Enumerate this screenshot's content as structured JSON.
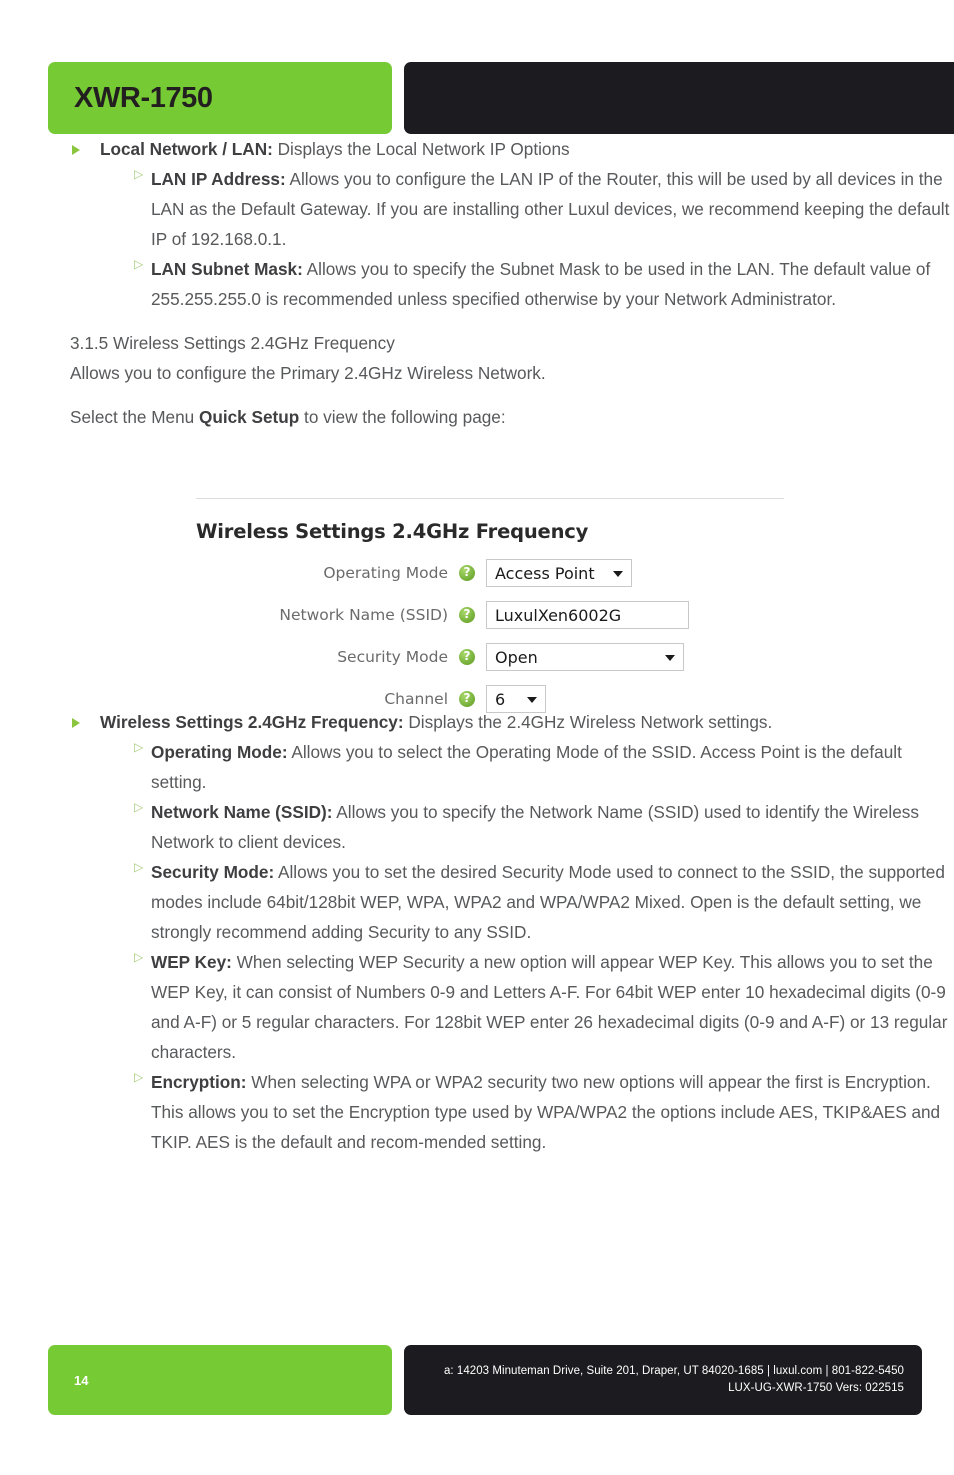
{
  "header": {
    "title": "XWR-1750"
  },
  "content": {
    "bullets_top": [
      {
        "label": "Local Network / LAN:",
        "text": " Displays the Local Network IP Options",
        "children": [
          {
            "label": "LAN IP Address:",
            "text": " Allows you to configure the LAN IP of the Router, this will be used by all devices in the LAN as the Default Gateway. If you are installing other Luxul devices, we recommend keeping the default IP of 192.168.0.1."
          },
          {
            "label": "LAN Subnet Mask:",
            "text": " Allows you to specify the Subnet Mask to be used in the LAN. The default value of 255.255.255.0 is recommended unless specified otherwise by your Network Administrator."
          }
        ]
      }
    ],
    "section_number_title": "3.1.5 Wireless Settings 2.4GHz Frequency",
    "section_intro": "Allows you to configure the Primary 2.4GHz Wireless Network.",
    "select_menu_pre": "Select the Menu ",
    "select_menu_bold": "Quick Setup",
    "select_menu_post": " to view the following page:",
    "bullets_bottom": [
      {
        "label": "Wireless Settings 2.4GHz Frequency:",
        "text": " Displays the 2.4GHz Wireless Network settings.",
        "children": [
          {
            "label": "Operating Mode:",
            "text": " Allows you to select the Operating Mode of the SSID. Access Point is the default setting."
          },
          {
            "label": "Network Name (SSID):",
            "text": " Allows you to specify the Network Name (SSID) used to identify the Wireless Network to client devices."
          },
          {
            "label": "Security Mode:",
            "text": " Allows you to set the desired Security Mode used to connect to the SSID, the supported modes include 64bit/128bit WEP, WPA, WPA2 and WPA/WPA2 Mixed. Open is the default setting, we strongly recommend adding Security to any SSID."
          },
          {
            "label": "WEP Key:",
            "text": " When selecting WEP Security a new option will appear WEP Key. This allows you to set the WEP Key, it can consist of Numbers 0-9 and Letters A-F. For 64bit WEP enter 10 hexadecimal digits (0-9 and A-F) or 5 regular characters. For 128bit WEP enter 26 hexadecimal digits (0-9 and A-F) or 13 regular characters."
          },
          {
            "label": "Encryption:",
            "text": " When selecting WPA or WPA2 security two new options will appear the first is Encryption. This allows you to set the Encryption type used by WPA/WPA2 the options include AES, TKIP&AES and TKIP. AES is the default and recom-mended setting."
          }
        ]
      }
    ]
  },
  "screenshot": {
    "title": "Wireless Settings 2.4GHz Frequency",
    "help_icon": "help-question-icon",
    "rows": [
      {
        "label": "Operating Mode",
        "value": "Access Point",
        "control": "select"
      },
      {
        "label": "Network Name (SSID)",
        "value": "LuxulXen6002G",
        "control": "text"
      },
      {
        "label": "Security Mode",
        "value": "Open",
        "control": "select"
      },
      {
        "label": "Channel",
        "value": "6",
        "control": "select"
      }
    ]
  },
  "footer": {
    "page_number": "14",
    "address_line": "a: 14203 Minuteman Drive, Suite 201, Draper, UT 84020-1685 | luxul.com | 801-822-5450",
    "doc_line": "LUX-UG-XWR-1750  Vers: 022515"
  },
  "colors": {
    "brand_green": "#76ca33",
    "bullet_green": "#8cc63f",
    "dark": "#1c1b1f",
    "body_text": "#58595b"
  }
}
